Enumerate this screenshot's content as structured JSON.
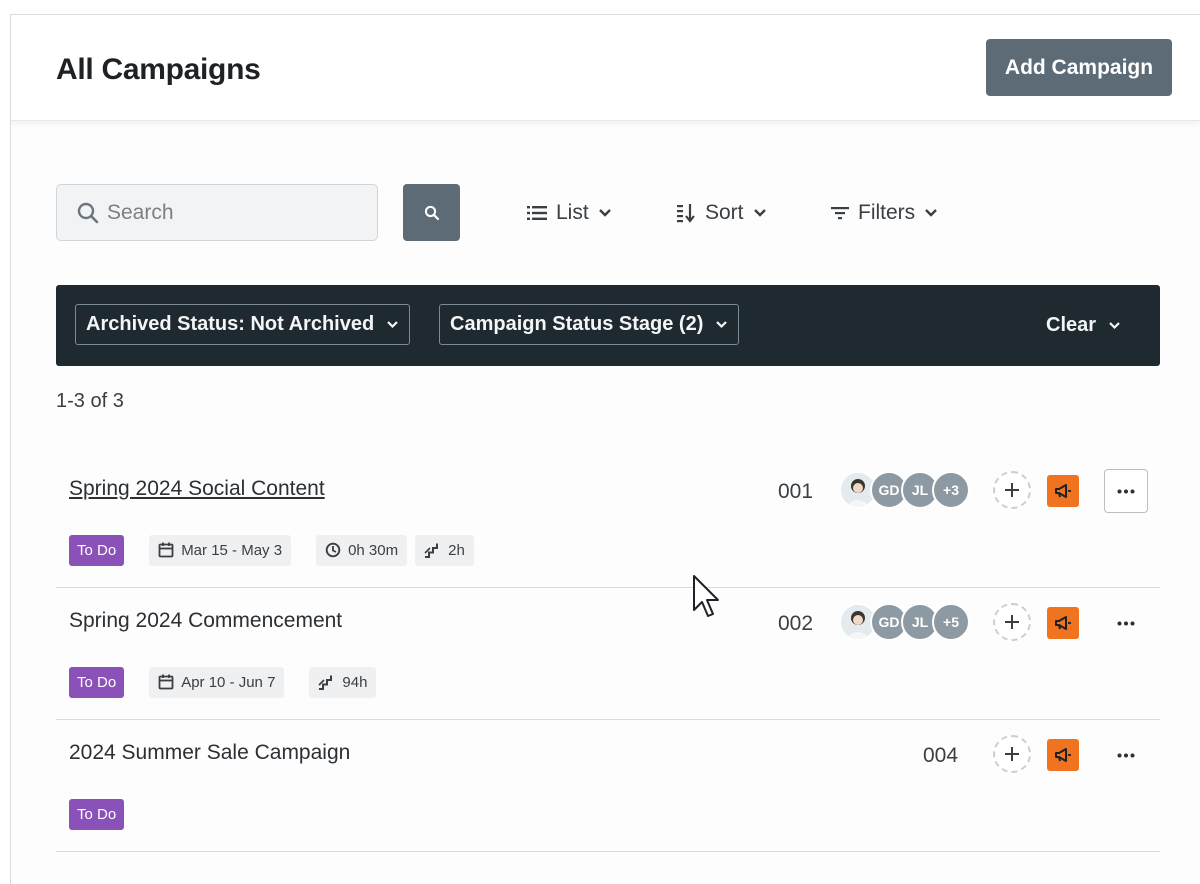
{
  "header": {
    "title": "All Campaigns",
    "add_button": "Add Campaign"
  },
  "toolbar": {
    "search_placeholder": "Search",
    "view_label": "List",
    "sort_label": "Sort",
    "filters_label": "Filters"
  },
  "filters": {
    "chips": [
      "Archived Status: Not Archived",
      "Campaign Status Stage (2)"
    ],
    "clear_label": "Clear"
  },
  "results_count": "1-3 of 3",
  "campaigns": [
    {
      "title": "Spring 2024 Social Content",
      "status": "To Do",
      "dates": "Mar 15 - May 3",
      "time_tracked": "0h 30m",
      "estimate": "2h",
      "id": "001",
      "assignees": [
        "GD",
        "JL"
      ],
      "assignees_extra": "+3"
    },
    {
      "title": "Spring 2024 Commencement",
      "status": "To Do",
      "dates": "Apr 10 - Jun 7",
      "estimate": "94h",
      "id": "002",
      "assignees": [
        "GD",
        "JL"
      ],
      "assignees_extra": "+5"
    },
    {
      "title": "2024 Summer Sale Campaign",
      "status": "To Do",
      "id": "004"
    }
  ],
  "colors": {
    "primary_button": "#5d6b77",
    "filter_bar": "#1f2a30",
    "status_badge": "#8a52b8",
    "campaign_icon": "#f0731f"
  }
}
